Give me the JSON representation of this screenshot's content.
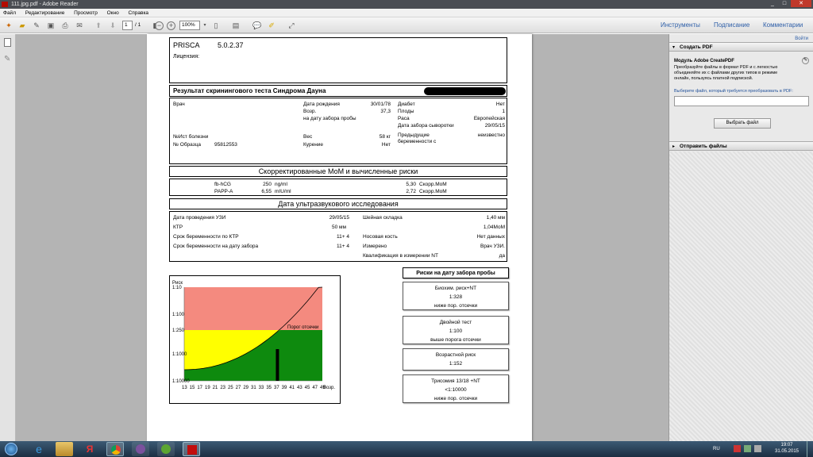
{
  "window": {
    "title": "111.jpg.pdf - Adobe Reader"
  },
  "menu": [
    "Файл",
    "Редактирование",
    "Просмотр",
    "Окно",
    "Справка"
  ],
  "toolbar": {
    "page_current": "1",
    "page_total": "/ 1",
    "zoom": "100%",
    "tabs": [
      "Инструменты",
      "Подписание",
      "Комментарии"
    ]
  },
  "right_panel": {
    "login": "Войти",
    "create_pdf": "Создать PDF",
    "module_title": "Модуль Adobe CreatePDF",
    "module_desc": "Преобразуйте файлы в формат PDF и с легкостью объединяйте их с файлами других типов в режиме онлайн, пользуясь платной подпиской.",
    "select_label": "Выберите файл, который требуется преобразовать в PDF:",
    "select_button": "Выбрать файл",
    "send_files": "Отправить файлы"
  },
  "report": {
    "lab": "PRISCA",
    "version": "5.0.2.37",
    "license": "Лицензия:",
    "title": "Результат скринингового теста Синдрома Дауна",
    "patient": {
      "doctor": "Врач",
      "dob_label": "Дата рождения",
      "dob": "30/01/78",
      "age_label": "Возр.",
      "age": "37,3",
      "age_note": "на дату забора пробы",
      "case_no": "№Ист болезни",
      "sample_label": "№ Образца",
      "sample": "95812553",
      "weight_label": "Вес",
      "weight": "58 кг",
      "smoking_label": "Курение",
      "smoking": "Нет",
      "diabetes_label": "Диабет",
      "diabetes": "Нет",
      "fetuses_label": "Плоды",
      "fetuses": "1",
      "race_label": "Раса",
      "race": "Европейская",
      "serum_label": "Дата забора сыворотки",
      "serum_date": "29/05/15",
      "prev_label": "Предыдущие беременности с",
      "prev": "неизвестно"
    },
    "mom_header": "Скорректированные МоМ и вычисленные риски",
    "mom": [
      {
        "name": "fb-hCG",
        "value": "250",
        "unit": "ng/ml",
        "mom": "5,30",
        "mom_label": "Скорр.MoM"
      },
      {
        "name": "PAPP-A",
        "value": "6,55",
        "unit": "mIU/ml",
        "mom": "2,72",
        "mom_label": "Скорр.MoM"
      }
    ],
    "us_header": "Дата ультразвукового исследования",
    "us": {
      "date_label": "Дата проведения УЗИ",
      "date": "29/05/15",
      "ktr_label": "КТР",
      "ktr": "50 мм",
      "ga_ktr_label": "Срок беременности по КТР",
      "ga_ktr": "11+  4",
      "ga_draw_label": "Срок беременности на дату забора",
      "ga_draw": "11+  4",
      "nt_label": "Шейная складка",
      "nt": "1,40  мм",
      "nt_mom": "1,04MoM",
      "nasal_label": "Носовая кость",
      "nasal": "Нет данных",
      "measured_label": "Измерено",
      "measured": "Врач УЗИ.",
      "qual_label": "Квалификация в измерении NT",
      "qual": "да"
    },
    "risks_header": "Риски на дату забора пробы",
    "risks": [
      {
        "title": "Биохим. риск+NT",
        "value": "1:328",
        "note": "ниже пор. отсечки"
      },
      {
        "title": "Двойной тест",
        "value": "1:100",
        "note": "выше порога отсечки"
      },
      {
        "title": "Возрастной риск",
        "value": "1:152",
        "note": ""
      },
      {
        "title": "Трисомия 13/18 +NT",
        "value": "<1:10000",
        "note": "ниже пор. отсечки"
      }
    ]
  },
  "chart_data": {
    "type": "area",
    "ylabel": "Риск",
    "xlabel": "Возр.",
    "y_ticks": [
      "1:10",
      "1:100",
      "1:250",
      "1:1000",
      "1:10000"
    ],
    "x_ticks": [
      13,
      15,
      17,
      19,
      21,
      23,
      25,
      27,
      29,
      31,
      33,
      35,
      37,
      39,
      41,
      43,
      45,
      47,
      49
    ],
    "xlim": [
      13,
      49
    ],
    "cutoff_label": "Порог отсечки",
    "cutoff": "1:250",
    "patient_age": 37.3,
    "colors": {
      "high": "#f48a7f",
      "mid": "#ffff00",
      "low": "#0e8a0e"
    }
  },
  "taskbar": {
    "lang": "RU",
    "time": "19:07",
    "date": "31.05.2015"
  }
}
